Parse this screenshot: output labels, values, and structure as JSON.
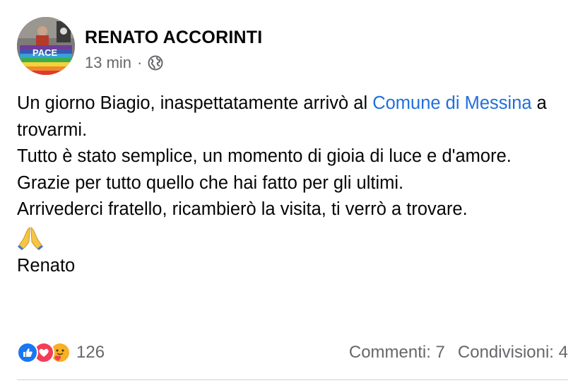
{
  "post": {
    "author": "RENATO ACCORINTI",
    "time": "13 min",
    "separator": "·",
    "privacy_icon": "globe-icon",
    "body": {
      "line1_before": "Un giorno Biagio, inaspettatamente arrivò al ",
      "link_text": "Comune di Messina",
      "line1_after": " a trovarmi.",
      "para2": "Tutto è stato semplice, un momento di gioia di luce e d'amore.",
      "para3": "Grazie per tutto quello che hai fatto per gli ultimi.",
      "para4": "Arrivederci fratello, ricambierò la visita, ti verrò a trovare.",
      "emoji": "🙏",
      "signature": "Renato"
    },
    "avatar_banner_text": "PACE"
  },
  "footer": {
    "reaction_icons": [
      "like-icon",
      "love-icon",
      "care-icon"
    ],
    "reaction_count": "126",
    "comments": "Commenti: 7",
    "shares": "Condivisioni: 4"
  },
  "colors": {
    "link": "#216fdb",
    "secondary_text": "#65676b",
    "like": "#1877f2",
    "love": "#f33e58",
    "care": "#f7b125"
  }
}
